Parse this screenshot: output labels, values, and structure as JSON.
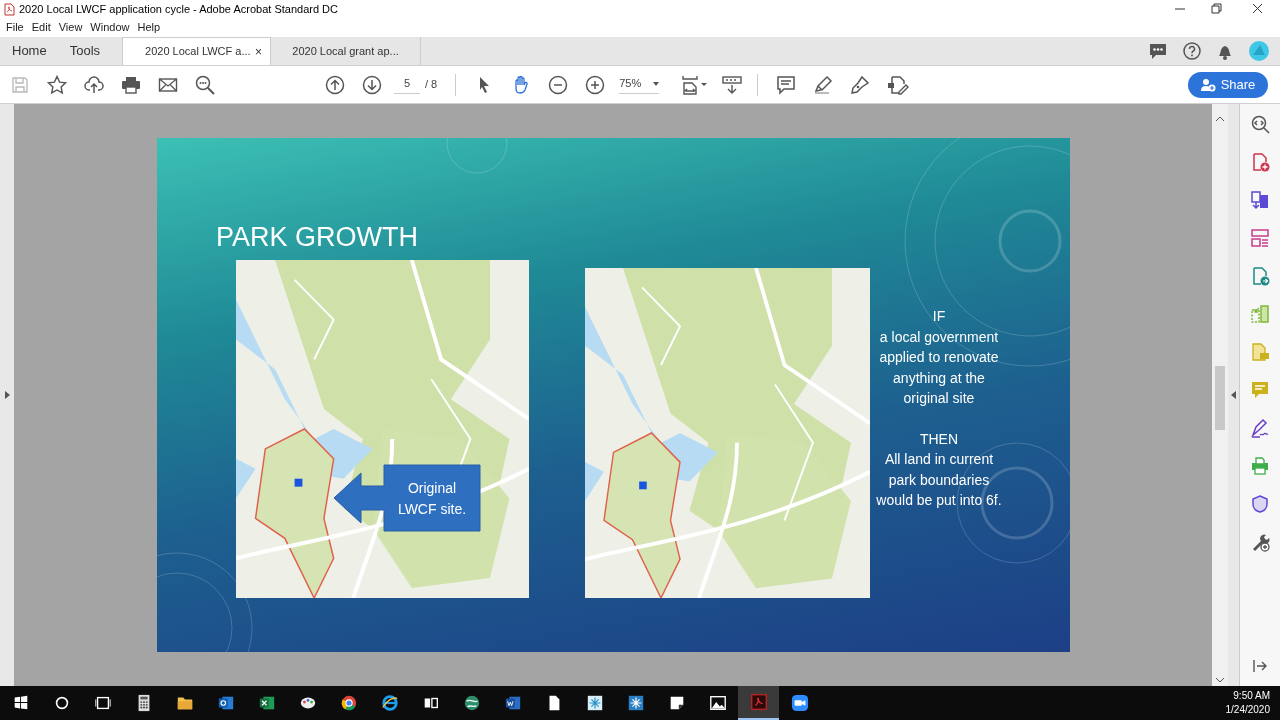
{
  "window": {
    "title": "2020 Local LWCF  application cycle - Adobe Acrobat Standard DC"
  },
  "menu": [
    "File",
    "Edit",
    "View",
    "Window",
    "Help"
  ],
  "nav_tabs": [
    "Home",
    "Tools"
  ],
  "doc_tabs": [
    {
      "label": "2020 Local LWCF  a...",
      "selected": true,
      "close": "×"
    },
    {
      "label": "2020 Local grant ap...",
      "selected": false
    }
  ],
  "toolbar": {
    "page": "5",
    "page_count": "/ 8",
    "zoom": "75%",
    "share": "Share"
  },
  "slide": {
    "title": "PARK GROWTH",
    "callout": "Original LWCF site.",
    "note": [
      {
        "heading": "IF",
        "body": "a local government applied to renovate anything at the original site"
      },
      {
        "heading": "THEN",
        "body": "All land in current park boundaries would be put into 6f."
      }
    ]
  },
  "taskbar": {
    "time": "9:50 AM",
    "date": "1/24/2020"
  }
}
